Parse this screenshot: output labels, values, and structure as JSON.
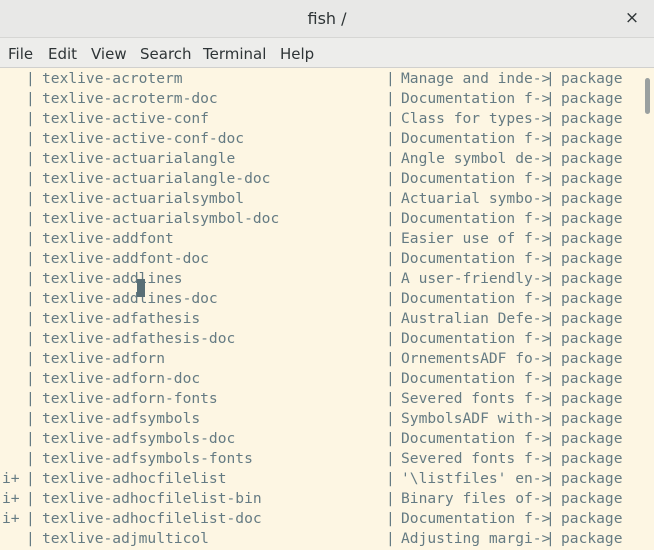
{
  "window": {
    "title": "fish  /",
    "close_glyph": "×"
  },
  "menu": [
    "File",
    "Edit",
    "View",
    "Search",
    "Terminal",
    "Help"
  ],
  "rows": [
    {
      "flag": "",
      "name": "texlive-acroterm",
      "desc": "Manage and inde->",
      "type": "package"
    },
    {
      "flag": "",
      "name": "texlive-acroterm-doc",
      "desc": "Documentation f->",
      "type": "package"
    },
    {
      "flag": "",
      "name": "texlive-active-conf",
      "desc": "Class for types->",
      "type": "package"
    },
    {
      "flag": "",
      "name": "texlive-active-conf-doc",
      "desc": "Documentation f->",
      "type": "package"
    },
    {
      "flag": "",
      "name": "texlive-actuarialangle",
      "desc": "Angle symbol de->",
      "type": "package"
    },
    {
      "flag": "",
      "name": "texlive-actuarialangle-doc",
      "desc": "Documentation f->",
      "type": "package"
    },
    {
      "flag": "",
      "name": "texlive-actuarialsymbol",
      "desc": "Actuarial symbo->",
      "type": "package"
    },
    {
      "flag": "",
      "name": "texlive-actuarialsymbol-doc",
      "desc": "Documentation f->",
      "type": "package"
    },
    {
      "flag": "",
      "name": "texlive-addfont",
      "desc": "Easier use of f->",
      "type": "package"
    },
    {
      "flag": "",
      "name": "texlive-addfont-doc",
      "desc": "Documentation f->",
      "type": "package"
    },
    {
      "flag": "",
      "name": "texlive-addlines",
      "desc": "A user-friendly->",
      "type": "package"
    },
    {
      "flag": "",
      "name": "texlive-addlines-doc",
      "desc": "Documentation f->",
      "type": "package"
    },
    {
      "flag": "",
      "name": "texlive-adfathesis",
      "desc": "Australian Defe->",
      "type": "package"
    },
    {
      "flag": "",
      "name": "texlive-adfathesis-doc",
      "desc": "Documentation f->",
      "type": "package"
    },
    {
      "flag": "",
      "name": "texlive-adforn",
      "desc": "OrnementsADF fo->",
      "type": "package"
    },
    {
      "flag": "",
      "name": "texlive-adforn-doc",
      "desc": "Documentation f->",
      "type": "package"
    },
    {
      "flag": "",
      "name": "texlive-adforn-fonts",
      "desc": "Severed fonts f->",
      "type": "package"
    },
    {
      "flag": "",
      "name": "texlive-adfsymbols",
      "desc": "SymbolsADF with->",
      "type": "package"
    },
    {
      "flag": "",
      "name": "texlive-adfsymbols-doc",
      "desc": "Documentation f->",
      "type": "package"
    },
    {
      "flag": "",
      "name": "texlive-adfsymbols-fonts",
      "desc": "Severed fonts f->",
      "type": "package"
    },
    {
      "flag": "i+",
      "name": "texlive-adhocfilelist",
      "desc": "'\\listfiles' en->",
      "type": "package"
    },
    {
      "flag": "i+",
      "name": "texlive-adhocfilelist-bin",
      "desc": "Binary files of->",
      "type": "package"
    },
    {
      "flag": "i+",
      "name": "texlive-adhocfilelist-doc",
      "desc": "Documentation f->",
      "type": "package"
    },
    {
      "flag": "",
      "name": "texlive-adjmulticol",
      "desc": "Adjusting margi->",
      "type": "package"
    }
  ],
  "separator": "|",
  "colors": {
    "background": "#fdf6e3",
    "text": "#657b83",
    "cursor": "#586e75"
  }
}
